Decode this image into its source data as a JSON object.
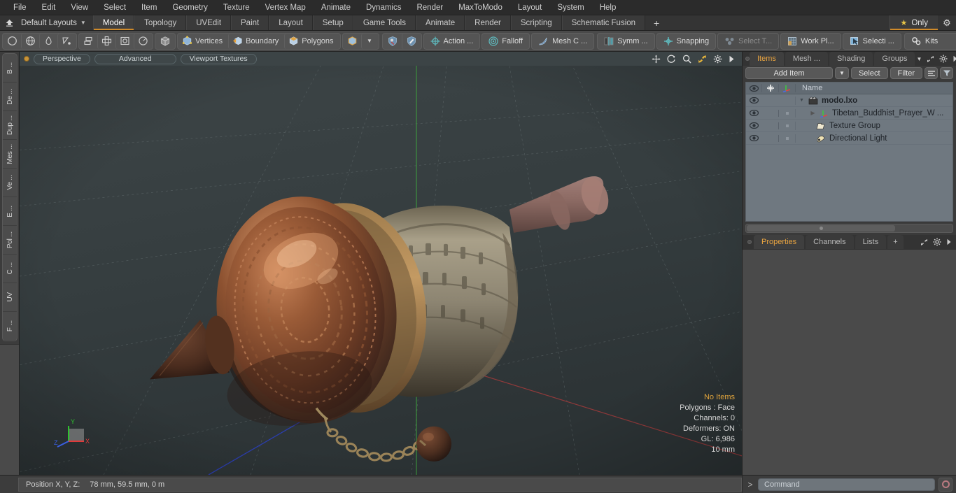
{
  "menubar": {
    "items": [
      "File",
      "Edit",
      "View",
      "Select",
      "Item",
      "Geometry",
      "Texture",
      "Vertex Map",
      "Animate",
      "Dynamics",
      "Render",
      "MaxToModo",
      "Layout",
      "System",
      "Help"
    ]
  },
  "layoutbar": {
    "home_icon": "home-icon",
    "layout_name": "Default Layouts",
    "caret": "▼",
    "tabs": [
      {
        "label": "Model",
        "active": true
      },
      {
        "label": "Topology",
        "active": false
      },
      {
        "label": "UVEdit",
        "active": false
      },
      {
        "label": "Paint",
        "active": false
      },
      {
        "label": "Layout",
        "active": false
      },
      {
        "label": "Setup",
        "active": false
      },
      {
        "label": "Game Tools",
        "active": false
      },
      {
        "label": "Animate",
        "active": false
      },
      {
        "label": "Render",
        "active": false
      },
      {
        "label": "Scripting",
        "active": false
      },
      {
        "label": "Schematic Fusion",
        "active": false
      }
    ],
    "add_tab": "+",
    "only_label": "Only",
    "star_glyph": "★",
    "gear_glyph": "⚙"
  },
  "toolbar": {
    "group1": [
      "circle-icon",
      "globe-icon",
      "pen-icon",
      "curve-icon"
    ],
    "group2": [
      "stack-icon",
      "array-icon",
      "bevel-icon",
      "radial-icon"
    ],
    "group3": [
      "cube-icon"
    ],
    "selection_modes": [
      {
        "label": "Vertices",
        "icon": "vertices-icon"
      },
      {
        "label": "Boundary",
        "icon": "boundary-icon"
      },
      {
        "label": "Polygons",
        "icon": "polygons-icon"
      }
    ],
    "mode_extra": {
      "icon": "cube-icon",
      "caret": "▼"
    },
    "shield_icons": [
      "shield-select-icon",
      "shield-paint-icon"
    ],
    "pills": [
      {
        "label": "Action  ...",
        "icon": "action-center-icon",
        "dim": false
      },
      {
        "label": "Falloff",
        "icon": "falloff-icon",
        "dim": false
      },
      {
        "label": "Mesh C ...",
        "icon": "mesh-constraint-icon",
        "dim": false
      },
      {
        "label": "Symm ...",
        "icon": "symmetry-icon",
        "dim": false
      },
      {
        "label": "Snapping",
        "icon": "snapping-icon",
        "dim": false
      },
      {
        "label": "Select T...",
        "icon": "select-through-icon",
        "dim": true
      },
      {
        "label": "Work Pl...",
        "icon": "work-plane-icon",
        "dim": false
      },
      {
        "label": "Selecti ...",
        "icon": "selection-set-icon",
        "dim": false
      }
    ],
    "kits": {
      "label": "Kits",
      "icon": "kits-gear-icon"
    },
    "app_icons": [
      "substance-cube-icon",
      "unreal-engine-icon"
    ]
  },
  "left_rail": {
    "tabs": [
      "B ...",
      "De ...",
      "Dup ...",
      "Mes ...",
      "Ve ...",
      "E ...",
      "Pol ...",
      "C ...",
      "UV",
      "F ..."
    ]
  },
  "viewport": {
    "header": {
      "dot": "viewport-indicator",
      "pills": [
        "Perspective",
        "Advanced",
        "Viewport Textures"
      ],
      "nav_icons": [
        "pan-icon",
        "rotate-icon",
        "zoom-icon",
        "fit-icon",
        "viewport-settings-icon",
        "viewport-more-icon"
      ]
    },
    "stats": {
      "items_label": "No Items",
      "polygons": "Polygons : Face",
      "channels": "Channels: 0",
      "deformers": "Deformers: ON",
      "gl": "GL: 6,986",
      "grid_size": "10 mm"
    },
    "gizmo": {
      "x": "X",
      "y": "Y",
      "z": "Z"
    },
    "model_name": "Tibetan Buddhist Prayer Wheel",
    "colors": {
      "background_top": "#3b4345",
      "background_bottom": "#2f3638",
      "axis_x": "#a33b3b",
      "axis_y": "#3fa03f",
      "axis_z": "#2b3fbb",
      "copper": "#8a4f30",
      "brass": "#8e7f5e",
      "wood": "#8d6a63"
    }
  },
  "right_panel": {
    "tabs": [
      {
        "label": "Items",
        "active": true
      },
      {
        "label": "Mesh ...",
        "active": false
      },
      {
        "label": "Shading",
        "active": false
      },
      {
        "label": "Groups",
        "active": false
      }
    ],
    "tab_tools": [
      "chevron-down-icon",
      "expand-icon",
      "gear-icon",
      "more-icon"
    ],
    "controls": {
      "add_item": "Add Item",
      "add_item_caret": "▼",
      "select": "Select",
      "filter": "Filter",
      "list_icon": "list-view-icon",
      "funnel_icon": "funnel-icon"
    },
    "tree": {
      "columns": {
        "eye": "visibility-icon",
        "lock": "lock-icon",
        "axis": "transform-icon",
        "name": "Name"
      },
      "rows": [
        {
          "name": "modo.lxo",
          "icon": "scene-icon",
          "depth": 0,
          "bold": true,
          "twisty": "▼"
        },
        {
          "name": "Tibetan_Buddhist_Prayer_W ...",
          "icon": "mesh-item-icon",
          "depth": 1,
          "bold": false,
          "twisty": "▶"
        },
        {
          "name": "Texture Group",
          "icon": "texture-group-icon",
          "depth": 1,
          "bold": false,
          "twisty": ""
        },
        {
          "name": "Directional Light",
          "icon": "light-icon",
          "depth": 1,
          "bold": false,
          "twisty": ""
        }
      ]
    },
    "lower_tabs": [
      {
        "label": "Properties",
        "active": true
      },
      {
        "label": "Channels",
        "active": false
      },
      {
        "label": "Lists",
        "active": false
      },
      {
        "label": "+",
        "active": false
      }
    ],
    "lower_tab_tools": [
      "expand-icon",
      "gear-icon",
      "more-icon"
    ]
  },
  "statusbar": {
    "position_label": "Position X, Y, Z:",
    "position_value": "78 mm, 59.5 mm, 0 m"
  },
  "command_line": {
    "prompt": ">",
    "placeholder": "Command",
    "record_button": "record-macro-button"
  }
}
